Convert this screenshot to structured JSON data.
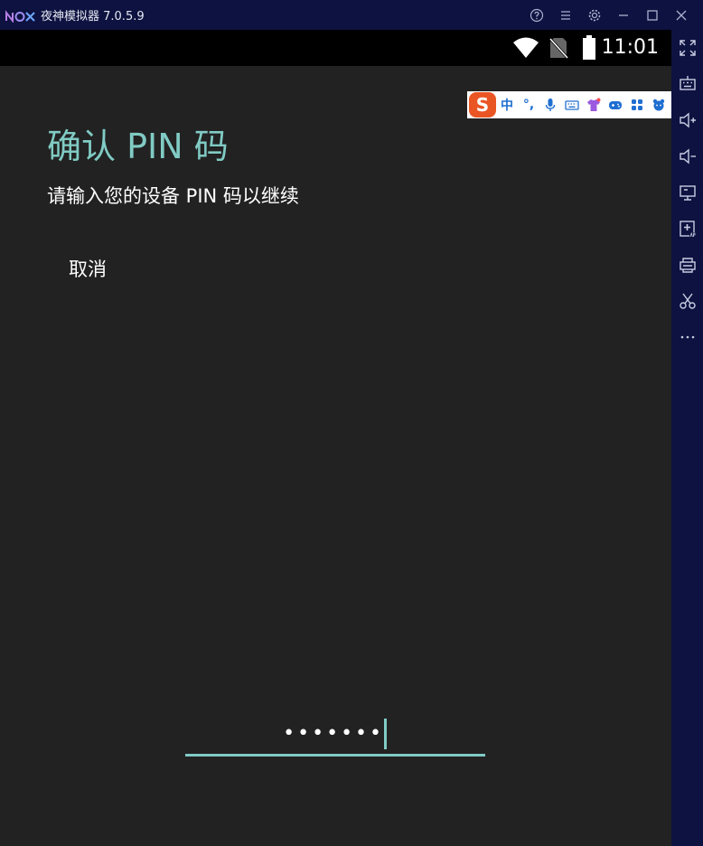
{
  "window": {
    "title": "夜神模拟器 7.0.5.9",
    "logo_icon": "nox-logo",
    "controls": [
      "help-icon",
      "menu-icon",
      "settings-icon",
      "minimize-icon",
      "maximize-icon",
      "close-icon"
    ]
  },
  "statusbar": {
    "time": "11:01",
    "icons": [
      "wifi-icon",
      "no-sim-icon",
      "battery-icon"
    ]
  },
  "ime": {
    "logo": "S",
    "items": [
      {
        "name": "ime-chinese-mode",
        "label": "中"
      },
      {
        "name": "ime-punctuation",
        "label": "°,"
      },
      {
        "name": "ime-voice",
        "icon": "microphone-icon"
      },
      {
        "name": "ime-keyboard",
        "icon": "keyboard-icon"
      },
      {
        "name": "ime-skin",
        "icon": "tshirt-icon"
      },
      {
        "name": "ime-game",
        "icon": "gamepad-icon"
      },
      {
        "name": "ime-toolbox",
        "icon": "grid-icon"
      },
      {
        "name": "ime-settings",
        "icon": "bear-icon"
      }
    ]
  },
  "page": {
    "heading": "确认 PIN 码",
    "subtitle": "请输入您的设备 PIN 码以继续",
    "cancel_label": "取消",
    "pin_masked": "•••••••",
    "accent_color": "#80cbc4"
  },
  "sidebar": {
    "buttons": [
      "fullscreen-icon",
      "keyboard-icon",
      "volume-up-icon",
      "volume-down-icon",
      "screen-icon",
      "add-apk-icon",
      "printer-icon",
      "scissors-icon",
      "more-icon"
    ]
  }
}
